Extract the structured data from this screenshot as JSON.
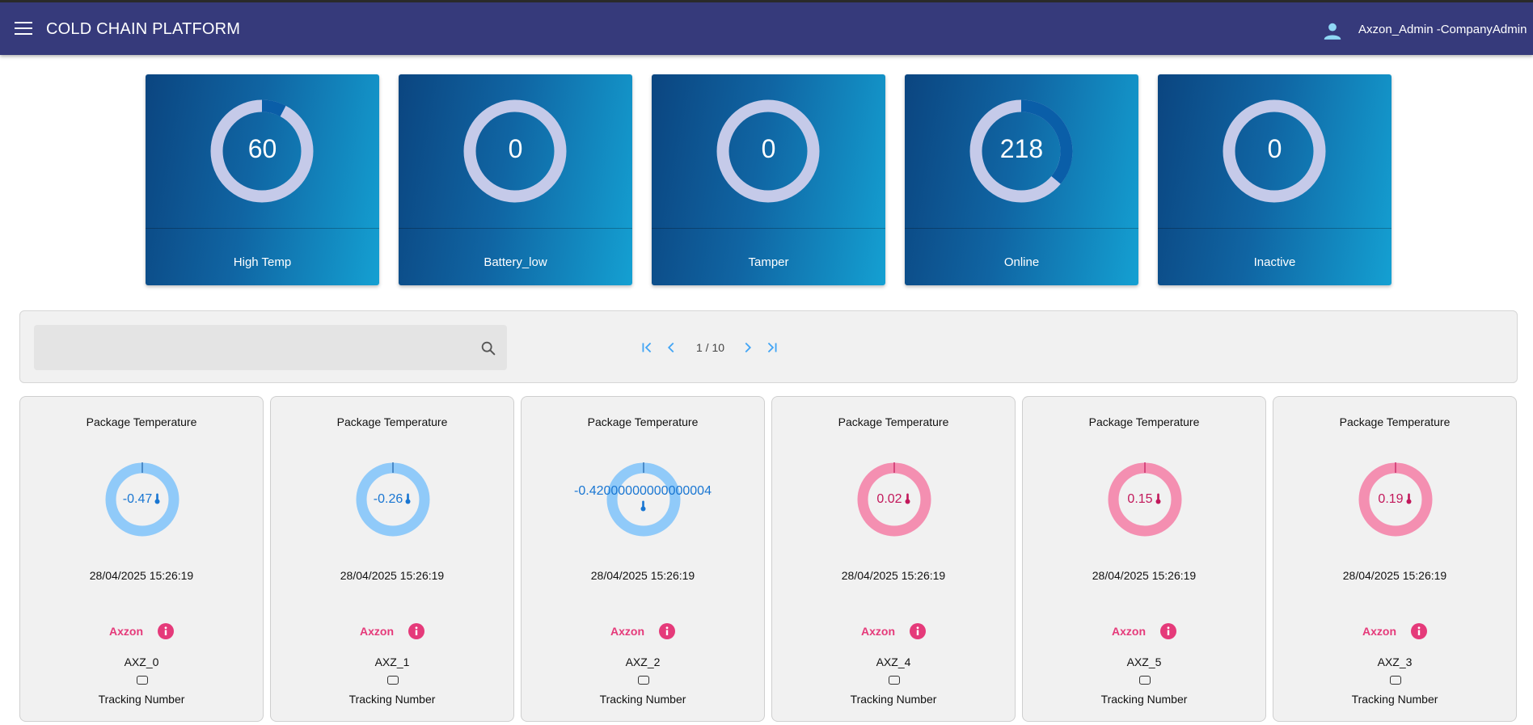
{
  "header": {
    "title": "COLD CHAIN PLATFORM",
    "user": "Axzon_Admin -CompanyAdmin",
    "menu_icon": "menu-icon",
    "user_icon": "person-icon"
  },
  "colors": {
    "header_bg": "#363a7b",
    "ring_track": "#c5cae9",
    "ring_fill": "#0a5ea8",
    "cold_ring": "#90caf9",
    "cold_text": "#1976d2",
    "warm_ring": "#f48fb1",
    "warm_text": "#c2185b",
    "brand": "#e53a7a"
  },
  "stats": [
    {
      "label": "High Temp",
      "value": "60",
      "fraction": 0.077
    },
    {
      "label": "Battery_low",
      "value": "0",
      "fraction": 0
    },
    {
      "label": "Tamper",
      "value": "0",
      "fraction": 0
    },
    {
      "label": "Online",
      "value": "218",
      "fraction": 0.36
    },
    {
      "label": "Inactive",
      "value": "0",
      "fraction": 0
    }
  ],
  "toolbar": {
    "search_value": "",
    "page_indicator": "1 / 10"
  },
  "packages": [
    {
      "title": "Package Temperature",
      "value": "-0.47",
      "state": "cold",
      "timestamp": "28/04/2025 15:26:19",
      "brand": "Axzon",
      "device": "AXZ_0",
      "tracking_label": "Tracking Number"
    },
    {
      "title": "Package Temperature",
      "value": "-0.26",
      "state": "cold",
      "timestamp": "28/04/2025 15:26:19",
      "brand": "Axzon",
      "device": "AXZ_1",
      "tracking_label": "Tracking Number"
    },
    {
      "title": "Package Temperature",
      "value": "-0.42000000000000004",
      "state": "cold",
      "timestamp": "28/04/2025 15:26:19",
      "brand": "Axzon",
      "device": "AXZ_2",
      "tracking_label": "Tracking Number"
    },
    {
      "title": "Package Temperature",
      "value": "0.02",
      "state": "warm",
      "timestamp": "28/04/2025 15:26:19",
      "brand": "Axzon",
      "device": "AXZ_4",
      "tracking_label": "Tracking Number"
    },
    {
      "title": "Package Temperature",
      "value": "0.15",
      "state": "warm",
      "timestamp": "28/04/2025 15:26:19",
      "brand": "Axzon",
      "device": "AXZ_5",
      "tracking_label": "Tracking Number"
    },
    {
      "title": "Package Temperature",
      "value": "0.19",
      "state": "warm",
      "timestamp": "28/04/2025 15:26:19",
      "brand": "Axzon",
      "device": "AXZ_3",
      "tracking_label": "Tracking Number"
    }
  ]
}
